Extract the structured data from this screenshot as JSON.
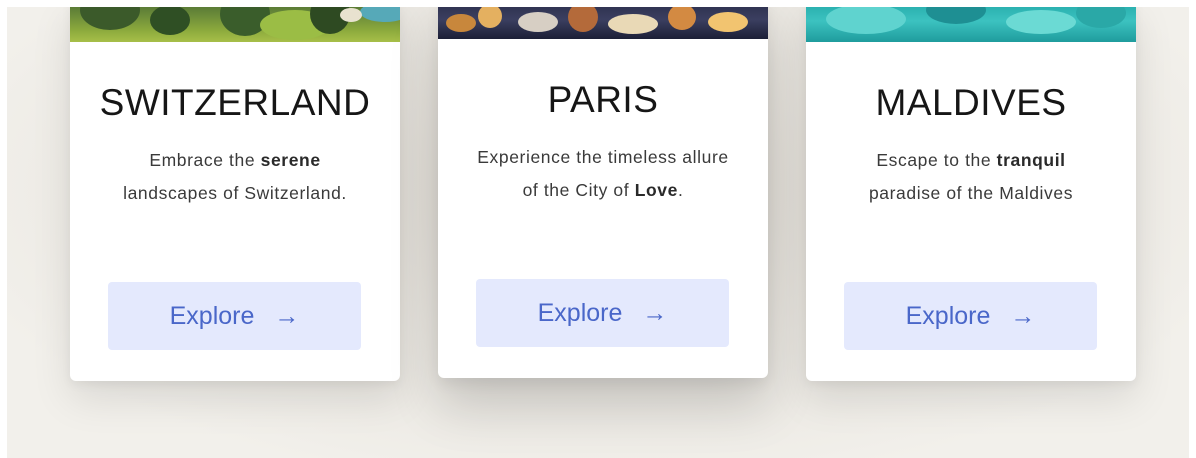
{
  "cards": [
    {
      "title": "SWITZERLAND",
      "desc_pre": "Embrace the ",
      "desc_bold": "serene",
      "desc_post": " landscapes of Switzerland.",
      "button_label": "Explore",
      "button_icon": "arrow-right-icon",
      "arrow": "→"
    },
    {
      "title": "PARIS",
      "desc_pre": "Experience the timeless allure of the City of ",
      "desc_bold": "Love",
      "desc_post": ".",
      "button_label": "Explore",
      "button_icon": "arrow-right-icon",
      "arrow": "→"
    },
    {
      "title": "MALDIVES",
      "desc_pre": "Escape to the ",
      "desc_bold": "tranquil",
      "desc_post": " paradise of the Maldives",
      "button_label": "Explore",
      "button_icon": "arrow-right-icon",
      "arrow": "→"
    }
  ],
  "colors": {
    "button_bg": "#e4e9fd",
    "button_text": "#4a67c9",
    "title_text": "#161616",
    "body_text": "#3a3a3a"
  }
}
